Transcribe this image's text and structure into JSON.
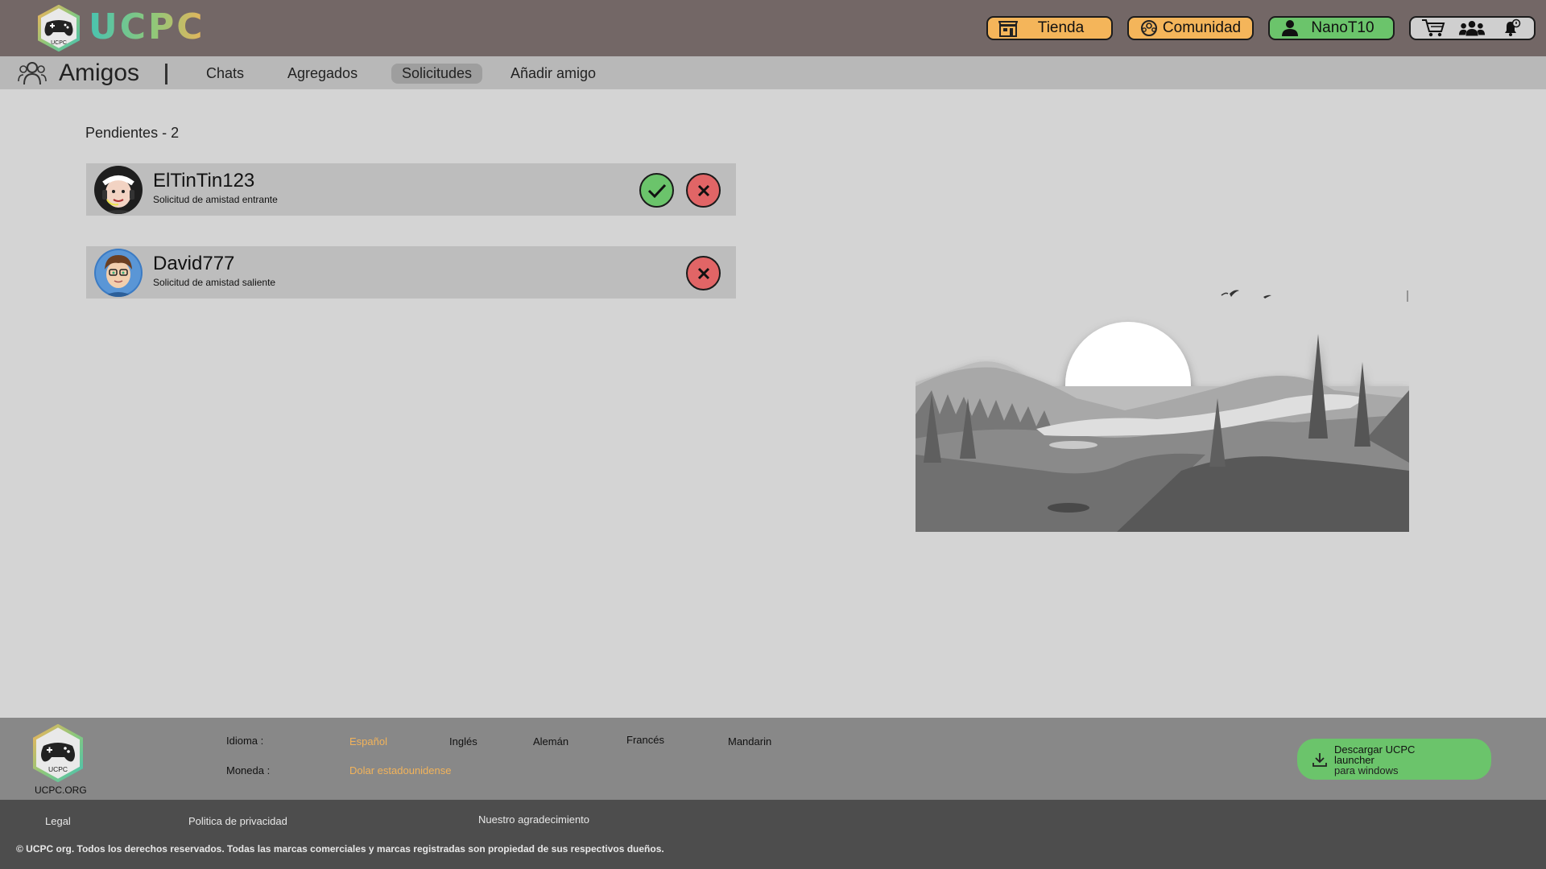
{
  "brand": {
    "name": "UCPC",
    "logo_text": "UCPC"
  },
  "header": {
    "store_label": "Tienda",
    "community_label": "Comunidad",
    "user_label": "NanoT10",
    "icons": [
      "cart-icon",
      "friends-icon",
      "notifications-icon"
    ]
  },
  "subnav": {
    "title": "Amigos",
    "tabs": [
      {
        "label": "Chats"
      },
      {
        "label": "Agregados"
      },
      {
        "label": "Solicitudes",
        "active": true
      },
      {
        "label": "Añadir amigo"
      }
    ]
  },
  "main": {
    "pending_title": "Pendientes - 2",
    "requests": [
      {
        "username": "ElTinTin123",
        "type": "Solicitud de amistad entrante",
        "actions": [
          "accept",
          "reject"
        ]
      },
      {
        "username": "David777",
        "type": "Solicitud de amistad saliente",
        "actions": [
          "reject"
        ]
      }
    ]
  },
  "footer": {
    "org": "UCPC.ORG",
    "language_label": "Idioma :",
    "languages": [
      "Español",
      "Inglés",
      "Alemán",
      "Francés",
      "Mandarin"
    ],
    "active_language": "Español",
    "currency_label": "Moneda :",
    "currency": "Dolar estadounidense",
    "download_title": "Descargar UCPC launcher",
    "download_sub": "para windows",
    "links": [
      "Legal",
      "Politica de privacidad",
      "Nuestro agradecimiento"
    ],
    "copyright": "© UCPC org. Todos los derechos reservados. Todas las marcas comerciales y marcas registradas son propiedad de sus respectivos dueños."
  },
  "colors": {
    "topbar": "#736766",
    "accent_orange": "#f4b55a",
    "accent_green": "#6bc46b",
    "reject_red": "#e16566",
    "page_bg": "#d4d4d4"
  }
}
